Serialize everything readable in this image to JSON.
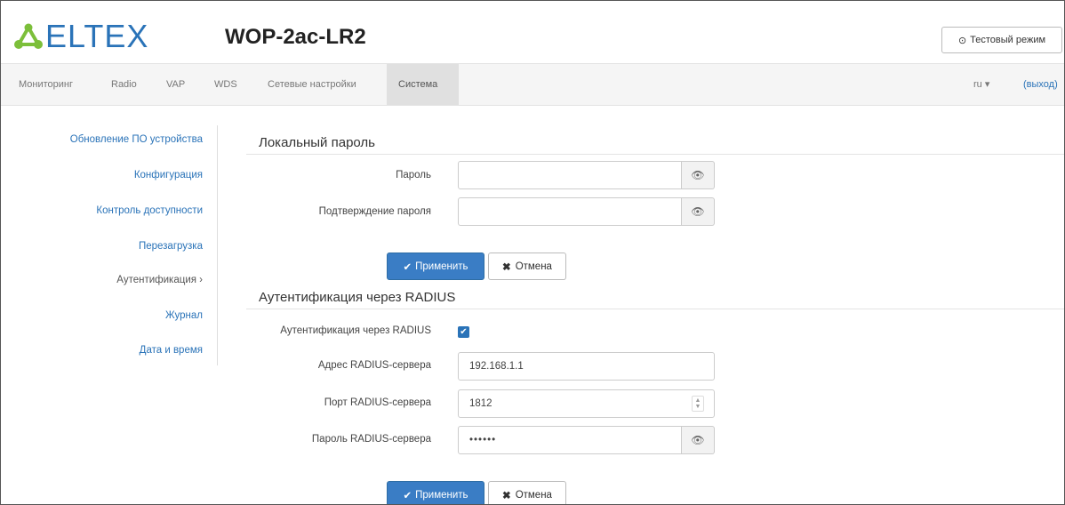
{
  "header": {
    "logo_text": "ELTEX",
    "device_model": "WOP-2ac-LR2",
    "test_mode_label": "Тестовый режим",
    "test_mode_icon": "clock-icon"
  },
  "nav": {
    "items": [
      {
        "label": "Мониторинг"
      },
      {
        "label": "Radio"
      },
      {
        "label": "VAP"
      },
      {
        "label": "WDS"
      },
      {
        "label": "Сетевые настройки"
      },
      {
        "label": "Система",
        "active": true
      }
    ],
    "language": "ru ▾",
    "logout": "(выход)"
  },
  "sidebar": {
    "items": [
      {
        "label": "Обновление ПО устройства"
      },
      {
        "label": "Конфигурация"
      },
      {
        "label": "Контроль доступности"
      },
      {
        "label": "Перезагрузка"
      },
      {
        "label": "Аутентификация ›",
        "active": true
      },
      {
        "label": "Журнал"
      },
      {
        "label": "Дата и время"
      }
    ]
  },
  "local_password": {
    "title": "Локальный пароль",
    "password_label": "Пароль",
    "password_value": "",
    "confirm_label": "Подтверждение пароля",
    "confirm_value": "",
    "apply_label": "Применить",
    "cancel_label": "Отмена"
  },
  "radius": {
    "title": "Аутентификация через RADIUS",
    "enable_label": "Аутентификация через RADIUS",
    "enabled": true,
    "server_address_label": "Адрес RADIUS-сервера",
    "server_address_value": "192.168.1.1",
    "server_port_label": "Порт RADIUS-сервера",
    "server_port_value": "1812",
    "server_password_label": "Пароль RADIUS-сервера",
    "server_password_value": "••••••",
    "apply_label": "Применить",
    "cancel_label": "Отмена"
  },
  "colors": {
    "brand": "#2a73b8",
    "logo_green": "#7cbf3a",
    "primary_button": "#3a7dc5"
  }
}
